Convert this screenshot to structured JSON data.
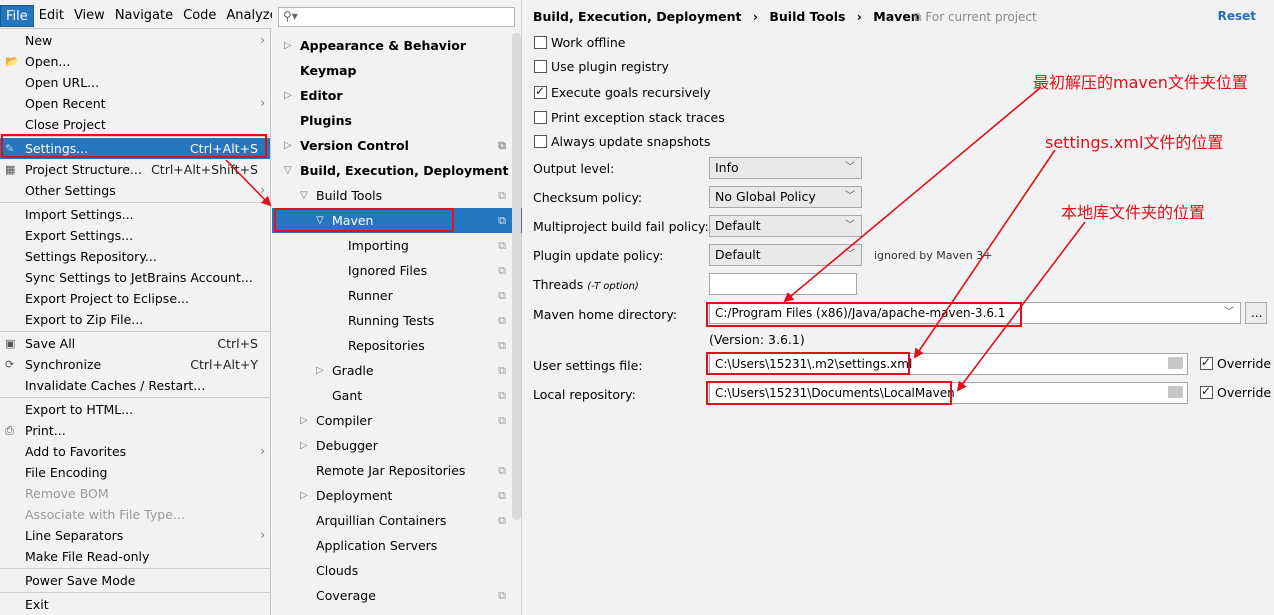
{
  "menubar": {
    "items": [
      "File",
      "Edit",
      "View",
      "Navigate",
      "Code",
      "Analyze"
    ]
  },
  "file_menu": {
    "items": [
      {
        "label": "New",
        "submenu": true
      },
      {
        "label": "Open...",
        "icon": "folder-open-icon"
      },
      {
        "label": "Open URL..."
      },
      {
        "label": "Open Recent",
        "submenu": true
      },
      {
        "label": "Close Project"
      },
      {
        "label": "Settings...",
        "shortcut": "Ctrl+Alt+S",
        "icon": "wrench-icon",
        "selected": true
      },
      {
        "label": "Project Structure...",
        "shortcut": "Ctrl+Alt+Shift+S",
        "icon": "project-structure-icon"
      },
      {
        "label": "Other Settings",
        "submenu": true
      },
      {
        "label": "Import Settings..."
      },
      {
        "label": "Export Settings..."
      },
      {
        "label": "Settings Repository..."
      },
      {
        "label": "Sync Settings to JetBrains Account..."
      },
      {
        "label": "Export Project to Eclipse..."
      },
      {
        "label": "Export to Zip File..."
      },
      {
        "label": "Save All",
        "shortcut": "Ctrl+S",
        "icon": "save-icon"
      },
      {
        "label": "Synchronize",
        "shortcut": "Ctrl+Alt+Y",
        "icon": "sync-icon"
      },
      {
        "label": "Invalidate Caches / Restart..."
      },
      {
        "label": "Export to HTML..."
      },
      {
        "label": "Print...",
        "icon": "print-icon"
      },
      {
        "label": "Add to Favorites",
        "submenu": true
      },
      {
        "label": "File Encoding"
      },
      {
        "label": "Remove BOM",
        "disabled": true
      },
      {
        "label": "Associate with File Type...",
        "disabled": true
      },
      {
        "label": "Line Separators",
        "submenu": true
      },
      {
        "label": "Make File Read-only"
      },
      {
        "label": "Power Save Mode"
      },
      {
        "label": "Exit"
      }
    ]
  },
  "search": {
    "placeholder": ""
  },
  "tree": [
    {
      "label": "Appearance & Behavior",
      "bold": true,
      "toggle": "collapsed"
    },
    {
      "label": "Keymap",
      "bold": true
    },
    {
      "label": "Editor",
      "bold": true,
      "toggle": "collapsed"
    },
    {
      "label": "Plugins",
      "bold": true
    },
    {
      "label": "Version Control",
      "bold": true,
      "toggle": "collapsed",
      "copy": true
    },
    {
      "label": "Build, Execution, Deployment",
      "bold": true,
      "toggle": "expanded"
    },
    {
      "label": "Build Tools",
      "toggle": "expanded",
      "copy": true
    },
    {
      "label": "Maven",
      "toggle": "expanded",
      "copy": true,
      "selected": true
    },
    {
      "label": "Importing",
      "copy": true
    },
    {
      "label": "Ignored Files",
      "copy": true
    },
    {
      "label": "Runner",
      "copy": true
    },
    {
      "label": "Running Tests",
      "copy": true
    },
    {
      "label": "Repositories",
      "copy": true
    },
    {
      "label": "Gradle",
      "toggle": "collapsed",
      "copy": true
    },
    {
      "label": "Gant",
      "copy": true
    },
    {
      "label": "Compiler",
      "toggle": "collapsed",
      "copy": true
    },
    {
      "label": "Debugger",
      "toggle": "collapsed"
    },
    {
      "label": "Remote Jar Repositories",
      "copy": true
    },
    {
      "label": "Deployment",
      "toggle": "collapsed",
      "copy": true
    },
    {
      "label": "Arquillian Containers",
      "copy": true
    },
    {
      "label": "Application Servers"
    },
    {
      "label": "Clouds"
    },
    {
      "label": "Coverage",
      "copy": true
    }
  ],
  "breadcrumb": {
    "parts": [
      "Build, Execution, Deployment",
      "Build Tools",
      "Maven"
    ],
    "separator": "›",
    "scope": "For current project",
    "reset": "Reset"
  },
  "options": {
    "work_offline": {
      "label": "Work offline",
      "checked": false
    },
    "use_plugin_registry": {
      "label": "Use plugin registry",
      "checked": false
    },
    "execute_goals": {
      "label": "Execute goals recursively",
      "checked": true
    },
    "print_exception": {
      "label": "Print exception stack traces",
      "checked": false
    },
    "always_update": {
      "label": "Always update snapshots",
      "checked": false
    }
  },
  "fields": {
    "output_level": {
      "label": "Output level:",
      "value": "Info"
    },
    "checksum_policy": {
      "label": "Checksum policy:",
      "value": "No Global Policy"
    },
    "multiproject_fail": {
      "label": "Multiproject build fail policy:",
      "value": "Default"
    },
    "plugin_update": {
      "label": "Plugin update policy:",
      "value": "Default",
      "note": "ignored by Maven 3+"
    },
    "threads": {
      "label": "Threads",
      "hint": "(-T option)",
      "value": ""
    },
    "maven_home": {
      "label": "Maven home directory:",
      "value": "C:/Program Files (x86)/Java/apache-maven-3.6.1",
      "version": "(Version: 3.6.1)",
      "browse": "..."
    },
    "user_settings": {
      "label": "User settings file:",
      "value": "C:\\Users\\15231\\.m2\\settings.xml",
      "override_label": "Override",
      "override": true
    },
    "local_repo": {
      "label": "Local repository:",
      "value": "C:\\Users\\15231\\Documents\\LocalMaven",
      "override_label": "Override",
      "override": true
    }
  },
  "annotations": {
    "maven_folder": "最初解压的maven文件夹位置",
    "settings_xml": "settings.xml文件的位置",
    "local_repo": "本地库文件夹的位置"
  },
  "colors": {
    "selection": "#2675bf",
    "annotation": "#e0101a"
  }
}
